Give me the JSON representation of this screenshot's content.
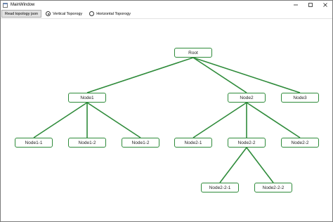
{
  "window": {
    "title": "MainWindow",
    "icon": "app-window-icon",
    "controls": [
      "minimize-icon",
      "maximize-icon",
      "close-icon"
    ]
  },
  "toolbar": {
    "read_button_label": "Read topology json",
    "vertical_label": "Vertical Toporogy",
    "vertical_checked": true,
    "horizontal_label": "Horizontal Toporogy",
    "horizontal_checked": false
  },
  "tree": {
    "edge_color": "#2e8b3a",
    "nodes": {
      "root": "Root",
      "node1": "Node1",
      "node2": "Node2",
      "node3": "Node3",
      "node1_1": "Node1-1",
      "node1_2": "Node1-2",
      "node1_3": "Node1-2",
      "node2_1": "Node2-1",
      "node2_2": "Node2-2",
      "node2_3": "Node2-2",
      "node2_2_1": "Node2-2-1",
      "node2_2_2": "Node2-2-2"
    },
    "edges": [
      [
        "root",
        "node1"
      ],
      [
        "root",
        "node2"
      ],
      [
        "root",
        "node3"
      ],
      [
        "node1",
        "node1_1"
      ],
      [
        "node1",
        "node1_2"
      ],
      [
        "node1",
        "node1_3"
      ],
      [
        "node2",
        "node2_1"
      ],
      [
        "node2",
        "node2_2"
      ],
      [
        "node2",
        "node2_3"
      ],
      [
        "node2_2",
        "node2_2_1"
      ],
      [
        "node2_2",
        "node2_2_2"
      ]
    ]
  }
}
